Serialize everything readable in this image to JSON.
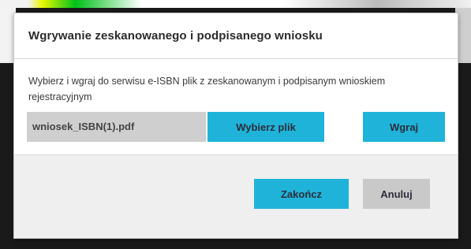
{
  "dialog": {
    "title": "Wgrywanie zeskanowanego i podpisanego wniosku",
    "description": "Wybierz i wgraj do serwisu e-ISBN plik z zeskanowanym i podpisanym wnioskiem rejestracyjnym",
    "file_name": "wniosek_ISBN(1).pdf",
    "browse_label": "Wybierz plik",
    "upload_label": "Wgraj",
    "finish_label": "Zakończ",
    "cancel_label": "Anuluj"
  },
  "colors": {
    "primary_button": "#1fb3d9",
    "secondary_button": "#c9c9c9",
    "file_field": "#cfcfcf",
    "overlay": "#1a1a1a"
  }
}
